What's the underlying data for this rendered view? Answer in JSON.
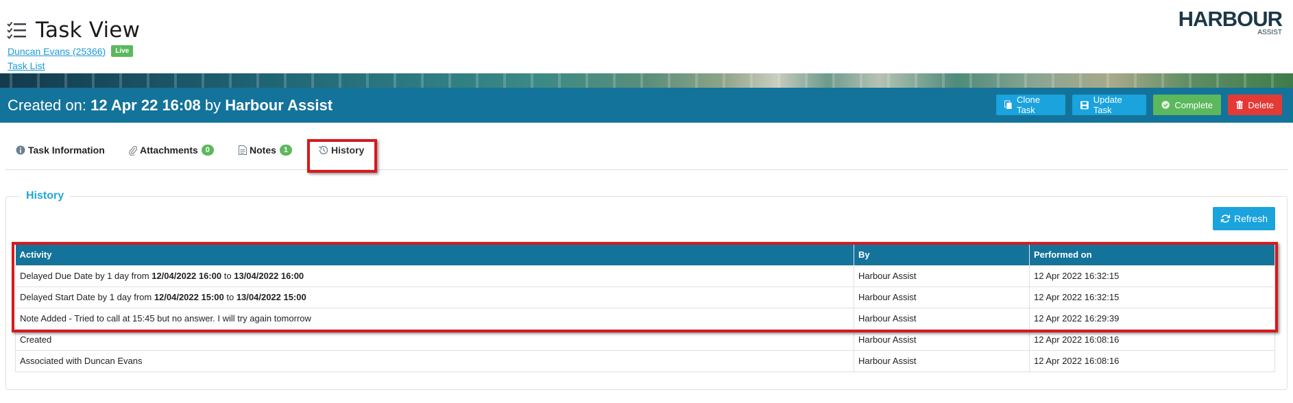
{
  "header": {
    "title": "Task View",
    "contact_link": "Duncan Evans (25366)",
    "status_badge": "Live",
    "task_list_link": "Task List"
  },
  "logo": {
    "main": "HARBOUR",
    "sub": "ASSIST"
  },
  "info_bar": {
    "created_prefix": "Created on:",
    "created_date": "12 Apr 22 16:08",
    "by_word": "by",
    "created_by": "Harbour Assist",
    "buttons": {
      "clone": "Clone Task",
      "update": "Update Task",
      "complete": "Complete",
      "delete": "Delete"
    }
  },
  "tabs": [
    {
      "label": "Task Information",
      "icon": "info-icon"
    },
    {
      "label": "Attachments",
      "count": "0",
      "icon": "paperclip-icon"
    },
    {
      "label": "Notes",
      "count": "1",
      "icon": "document-icon"
    },
    {
      "label": "History",
      "icon": "history-icon",
      "active": true
    }
  ],
  "history": {
    "section_title": "History",
    "refresh_label": "Refresh",
    "columns": [
      "Activity",
      "By",
      "Performed on"
    ],
    "rows": [
      {
        "prefix": "Delayed Due Date by 1 day  from ",
        "from": "12/04/2022 16:00",
        "mid": "  to ",
        "to": "13/04/2022 16:00",
        "by": "Harbour Assist",
        "performed_on": "12 Apr 2022 16:32:15"
      },
      {
        "prefix": "Delayed Start Date by 1 day  from ",
        "from": "12/04/2022 15:00",
        "mid": "  to ",
        "to": "13/04/2022 15:00",
        "by": "Harbour Assist",
        "performed_on": "12 Apr 2022 16:32:15"
      },
      {
        "activity": "Note Added - Tried to call at 15:45 but no answer. I will try again tomorrow",
        "by": "Harbour Assist",
        "performed_on": "12 Apr 2022 16:29:39"
      },
      {
        "activity": "Created",
        "by": "Harbour Assist",
        "performed_on": "12 Apr 2022 16:08:16"
      },
      {
        "activity": "Associated with Duncan Evans",
        "by": "Harbour Assist",
        "performed_on": "12 Apr 2022 16:08:16"
      }
    ]
  },
  "colors": {
    "primary_bar": "#14739a",
    "button_blue": "#1aa3dd",
    "button_green": "#5cb85c",
    "button_red": "#e53935",
    "highlight_red": "#d7191c",
    "legend_blue": "#22a5d7"
  }
}
